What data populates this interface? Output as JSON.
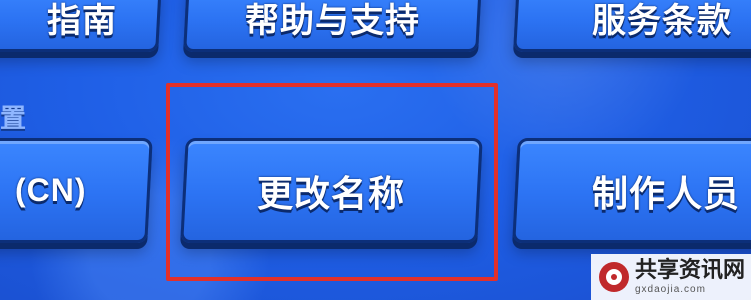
{
  "buttons": {
    "guide": "指南",
    "help_support": "帮助与支持",
    "terms": "服务条款",
    "region": "(CN)",
    "rename": "更改名称",
    "credits": "制作人员"
  },
  "section_label": "置",
  "watermark": {
    "title": "共享资讯网",
    "url": "gxdaojia.com"
  },
  "colors": {
    "button_blue": "#2c73f3",
    "background_blue": "#1f5fe6",
    "highlight_red": "#e2302a",
    "watermark_red": "#c0292b"
  }
}
